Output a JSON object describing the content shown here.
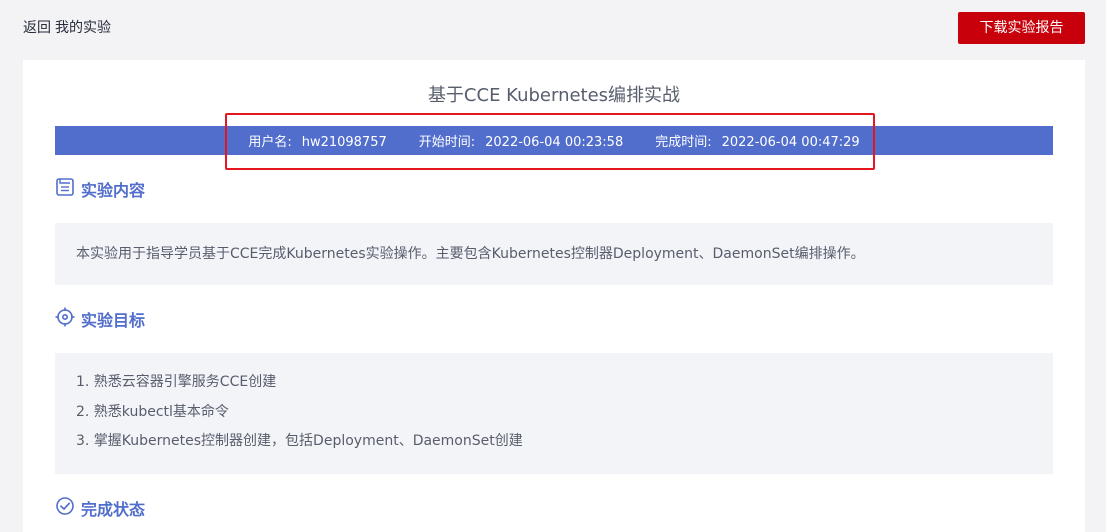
{
  "header": {
    "back_label": "返回",
    "breadcrumb_current": "我的实验",
    "download_button": "下载实验报告"
  },
  "report": {
    "title": "基于CCE Kubernetes编排实战",
    "info": {
      "username_label": "用户名:",
      "username": "hw21098757",
      "start_label": "开始时间:",
      "start_time": "2022-06-04 00:23:58",
      "end_label": "完成时间:",
      "end_time": "2022-06-04 00:47:29"
    }
  },
  "sections": {
    "content": {
      "title": "实验内容",
      "text": "本实验用于指导学员基于CCE完成Kubernetes实验操作。主要包含Kubernetes控制器Deployment、DaemonSet编排操作。"
    },
    "goals": {
      "title": "实验目标",
      "items": [
        "1. 熟悉云容器引擎服务CCE创建",
        "2. 熟悉kubectl基本命令",
        "3. 掌握Kubernetes控制器创建，包括Deployment、DaemonSet创建"
      ]
    },
    "status": {
      "title": "完成状态"
    }
  },
  "colors": {
    "accent": "#526ecc",
    "brand_red": "#c7000b",
    "highlight": "#e4161f"
  },
  "icons": {
    "content": "document-icon",
    "goals": "target-icon",
    "status": "check-circle-icon"
  }
}
